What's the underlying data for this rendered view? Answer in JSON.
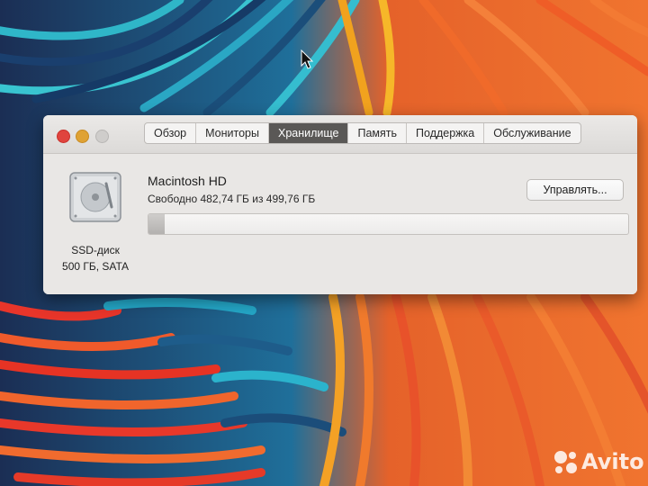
{
  "window": {
    "tabs": [
      {
        "label": "Обзор",
        "active": false
      },
      {
        "label": "Мониторы",
        "active": false
      },
      {
        "label": "Хранилище",
        "active": true
      },
      {
        "label": "Память",
        "active": false
      },
      {
        "label": "Поддержка",
        "active": false
      },
      {
        "label": "Обслуживание",
        "active": false
      }
    ]
  },
  "storage": {
    "disk_type": "SSD-диск",
    "disk_size": "500 ГБ, SATA",
    "volume_name": "Macintosh HD",
    "free_text": "Свободно 482,74 ГБ из 499,76 ГБ",
    "manage_label": "Управлять...",
    "used_fraction": 0.034
  },
  "watermark": {
    "text": "Avito"
  },
  "colors": {
    "close": "#e0443e",
    "minimize": "#dfa234",
    "active_tab": "#5a5856"
  }
}
